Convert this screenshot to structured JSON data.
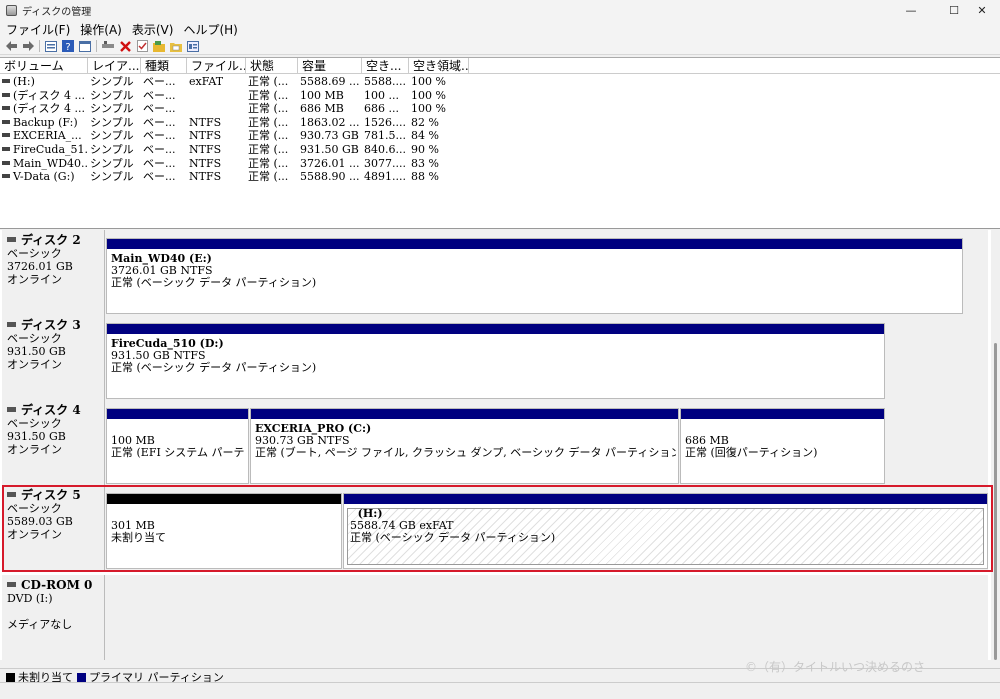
{
  "window": {
    "title": "ディスクの管理",
    "minimize": "—",
    "maximize": "☐",
    "close": "✕"
  },
  "menu": [
    "ファイル(F)",
    "操作(A)",
    "表示(V)",
    "ヘルプ(H)"
  ],
  "toolbar": [
    "back-arrow-icon",
    "forward-arrow-icon",
    "properties-icon",
    "help-icon",
    "view-icon",
    "connect-icon",
    "delete-icon",
    "check-icon",
    "folder-icon",
    "open-folder-icon",
    "settings-icon"
  ],
  "volume_table": {
    "columns": [
      "ボリューム",
      "レイア...",
      "種類",
      "ファイル...",
      "状態",
      "容量",
      "空き...",
      "空き領域..."
    ],
    "rows": [
      [
        "(H:)",
        "シンプル",
        "ベー...",
        "exFAT",
        "正常 (...",
        "5588.69 ...",
        "5588....",
        "100 %"
      ],
      [
        "(ディスク 4 ...",
        "シンプル",
        "ベー...",
        "",
        "正常 (...",
        "100 MB",
        "100 ...",
        "100 %"
      ],
      [
        "(ディスク 4 ...",
        "シンプル",
        "ベー...",
        "",
        "正常 (...",
        "686 MB",
        "686 ...",
        "100 %"
      ],
      [
        "Backup (F:)",
        "シンプル",
        "ベー...",
        "NTFS",
        "正常 (...",
        "1863.02 ...",
        "1526....",
        "82 %"
      ],
      [
        "EXCERIA_...",
        "シンプル",
        "ベー...",
        "NTFS",
        "正常 (...",
        "930.73 GB",
        "781.5...",
        "84 %"
      ],
      [
        "FireCuda_51...",
        "シンプル",
        "ベー...",
        "NTFS",
        "正常 (...",
        "931.50 GB",
        "840.6...",
        "90 %"
      ],
      [
        "Main_WD40...",
        "シンプル",
        "ベー...",
        "NTFS",
        "正常 (...",
        "3726.01 ...",
        "3077....",
        "83 %"
      ],
      [
        "V-Data (G:)",
        "シンプル",
        "ベー...",
        "NTFS",
        "正常 (...",
        "5588.90 ...",
        "4891....",
        "88 %"
      ]
    ]
  },
  "colors": {
    "primary": "#000080",
    "unallocated": "#000000",
    "selection": "#d61a2b"
  },
  "disks": [
    {
      "name": "ディスク 2",
      "type": "ベーシック",
      "size": "3726.01 GB",
      "status": "オンライン",
      "partitions": [
        {
          "kind": "primary",
          "name": "Main_WD40  (E:)",
          "size": "3726.01 GB NTFS",
          "status": "正常 (ベーシック データ パーティション)"
        }
      ]
    },
    {
      "name": "ディスク 3",
      "type": "ベーシック",
      "size": "931.50 GB",
      "status": "オンライン",
      "partitions": [
        {
          "kind": "primary",
          "name": "FireCuda_510  (D:)",
          "size": "931.50 GB NTFS",
          "status": "正常 (ベーシック データ パーティション)"
        }
      ]
    },
    {
      "name": "ディスク 4",
      "type": "ベーシック",
      "size": "931.50 GB",
      "status": "オンライン",
      "partitions": [
        {
          "kind": "primary",
          "name": "",
          "size": "100 MB",
          "status": "正常 (EFI システム パーテ"
        },
        {
          "kind": "primary",
          "name": "EXCERIA_PRO  (C:)",
          "size": "930.73 GB NTFS",
          "status": "正常 (ブート, ページ ファイル, クラッシュ ダンプ, ベーシック データ パーティション)"
        },
        {
          "kind": "primary",
          "name": "",
          "size": "686 MB",
          "status": "正常 (回復パーティション)"
        }
      ]
    },
    {
      "name": "ディスク 5",
      "type": "ベーシック",
      "size": "5589.03 GB",
      "status": "オンライン",
      "partitions": [
        {
          "kind": "unallocated",
          "name": "",
          "size": "301 MB",
          "status": "未割り当て"
        },
        {
          "kind": "primary",
          "name": "(H:)",
          "size": "5588.74 GB exFAT",
          "status": "正常 (ベーシック データ パーティション)"
        }
      ]
    },
    {
      "name": "CD-ROM 0",
      "type": "DVD (I:)",
      "size": "",
      "status": "メディアなし",
      "partitions": []
    }
  ],
  "legend": [
    {
      "label": "未割り当て",
      "color": "#000000"
    },
    {
      "label": "プライマリ パーティション",
      "color": "#000080"
    }
  ],
  "watermark": "©（有）タイトルいつ決めるのさ"
}
